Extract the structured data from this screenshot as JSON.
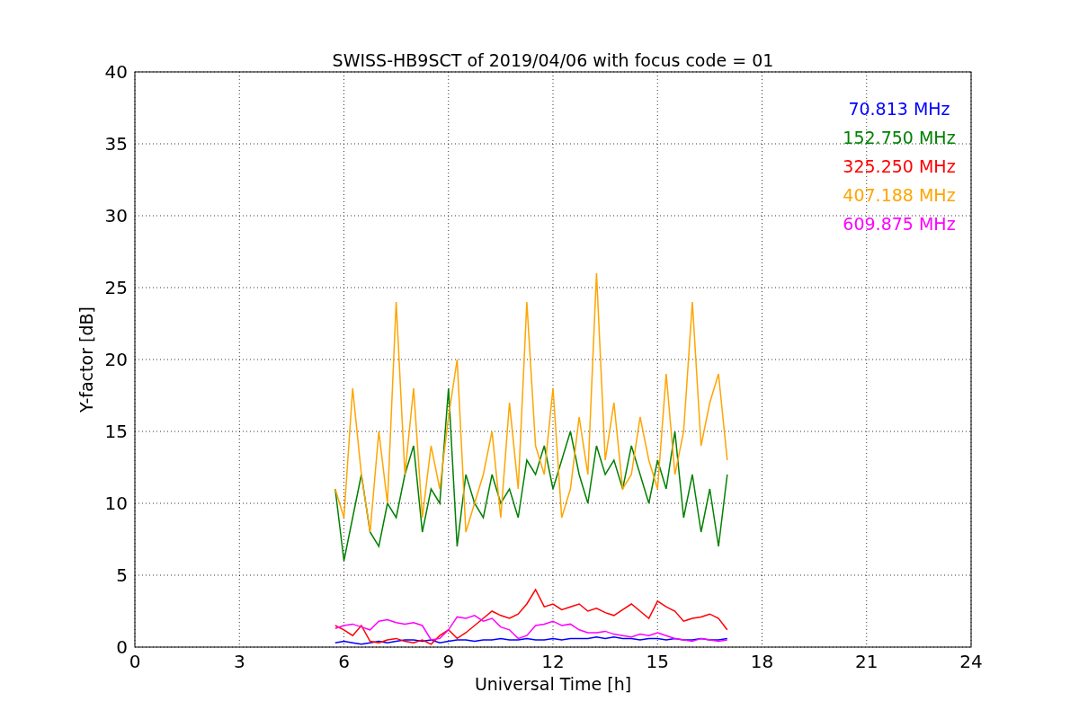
{
  "chart_data": {
    "type": "line",
    "title": "SWISS-HB9SCT of 2019/04/06 with focus code = 01",
    "xlabel": "Universal Time [h]",
    "ylabel": "Y-factor [dB]",
    "x": [
      5.75,
      6,
      6.25,
      6.5,
      6.75,
      7,
      7.25,
      7.5,
      7.75,
      8,
      8.25,
      8.5,
      8.75,
      9,
      9.25,
      9.5,
      9.75,
      10,
      10.25,
      10.5,
      10.75,
      11,
      11.25,
      11.5,
      11.75,
      12,
      12.25,
      12.5,
      12.75,
      13,
      13.25,
      13.5,
      13.75,
      14,
      14.25,
      14.5,
      14.75,
      15,
      15.25,
      15.5,
      15.75,
      16,
      16.25,
      16.5,
      16.75,
      17
    ],
    "xlim": [
      0,
      24
    ],
    "ylim": [
      0,
      40
    ],
    "xticks": [
      0,
      3,
      6,
      9,
      12,
      15,
      18,
      21,
      24
    ],
    "yticks": [
      0,
      5,
      10,
      15,
      20,
      25,
      30,
      35,
      40
    ],
    "grid": true,
    "series": [
      {
        "name": "70.813 MHz",
        "color": "#0000ff",
        "values": [
          0.3,
          0.4,
          0.3,
          0.2,
          0.3,
          0.4,
          0.3,
          0.4,
          0.5,
          0.5,
          0.4,
          0.5,
          0.3,
          0.4,
          0.5,
          0.5,
          0.4,
          0.5,
          0.5,
          0.6,
          0.5,
          0.5,
          0.6,
          0.5,
          0.5,
          0.6,
          0.5,
          0.6,
          0.6,
          0.6,
          0.7,
          0.6,
          0.7,
          0.6,
          0.6,
          0.5,
          0.6,
          0.6,
          0.5,
          0.6,
          0.5,
          0.5,
          0.6,
          0.5,
          0.5,
          0.6
        ]
      },
      {
        "name": "152.750 MHz",
        "color": "#008000",
        "values": [
          11,
          6,
          9,
          12,
          8,
          7,
          10,
          9,
          12,
          14,
          8,
          11,
          10,
          18,
          7,
          12,
          10,
          9,
          12,
          10,
          11,
          9,
          13,
          12,
          14,
          11,
          13,
          15,
          12,
          10,
          14,
          12,
          13,
          11,
          14,
          12,
          10,
          13,
          11,
          15,
          9,
          12,
          8,
          11,
          7,
          12
        ]
      },
      {
        "name": "325.250 MHz",
        "color": "#ff0000",
        "values": [
          1.5,
          1.2,
          0.8,
          1.5,
          0.4,
          0.3,
          0.5,
          0.6,
          0.4,
          0.3,
          0.5,
          0.2,
          0.8,
          1.2,
          0.6,
          1.0,
          1.5,
          2.0,
          2.5,
          2.2,
          2.0,
          2.3,
          3.0,
          4.0,
          2.8,
          3.0,
          2.6,
          2.8,
          3.0,
          2.5,
          2.7,
          2.4,
          2.2,
          2.6,
          3.0,
          2.5,
          2.0,
          3.2,
          2.8,
          2.5,
          1.8,
          2.0,
          2.1,
          2.3,
          2.0,
          1.2
        ]
      },
      {
        "name": "407.188 MHz",
        "color": "#ffa500",
        "values": [
          11,
          9,
          18,
          12,
          8,
          15,
          10,
          24,
          12,
          18,
          9,
          14,
          11,
          16,
          20,
          8,
          10,
          12,
          15,
          9,
          17,
          11,
          24,
          14,
          12,
          18,
          9,
          11,
          16,
          12,
          26,
          13,
          17,
          11,
          12,
          16,
          13,
          11,
          19,
          12,
          15,
          24,
          14,
          17,
          19,
          13
        ]
      },
      {
        "name": "609.875 MHz",
        "color": "#ff00ff",
        "values": [
          1.3,
          1.5,
          1.6,
          1.4,
          1.2,
          1.8,
          1.9,
          1.7,
          1.6,
          1.7,
          1.5,
          0.5,
          0.6,
          1.2,
          2.1,
          2.0,
          2.2,
          1.8,
          2.0,
          1.4,
          1.2,
          0.6,
          0.8,
          1.5,
          1.6,
          1.8,
          1.5,
          1.6,
          1.2,
          1.0,
          1.0,
          1.1,
          0.9,
          0.8,
          0.7,
          0.9,
          0.8,
          1.0,
          0.8,
          0.6,
          0.5,
          0.4,
          0.6,
          0.5,
          0.4,
          0.5
        ]
      }
    ]
  }
}
